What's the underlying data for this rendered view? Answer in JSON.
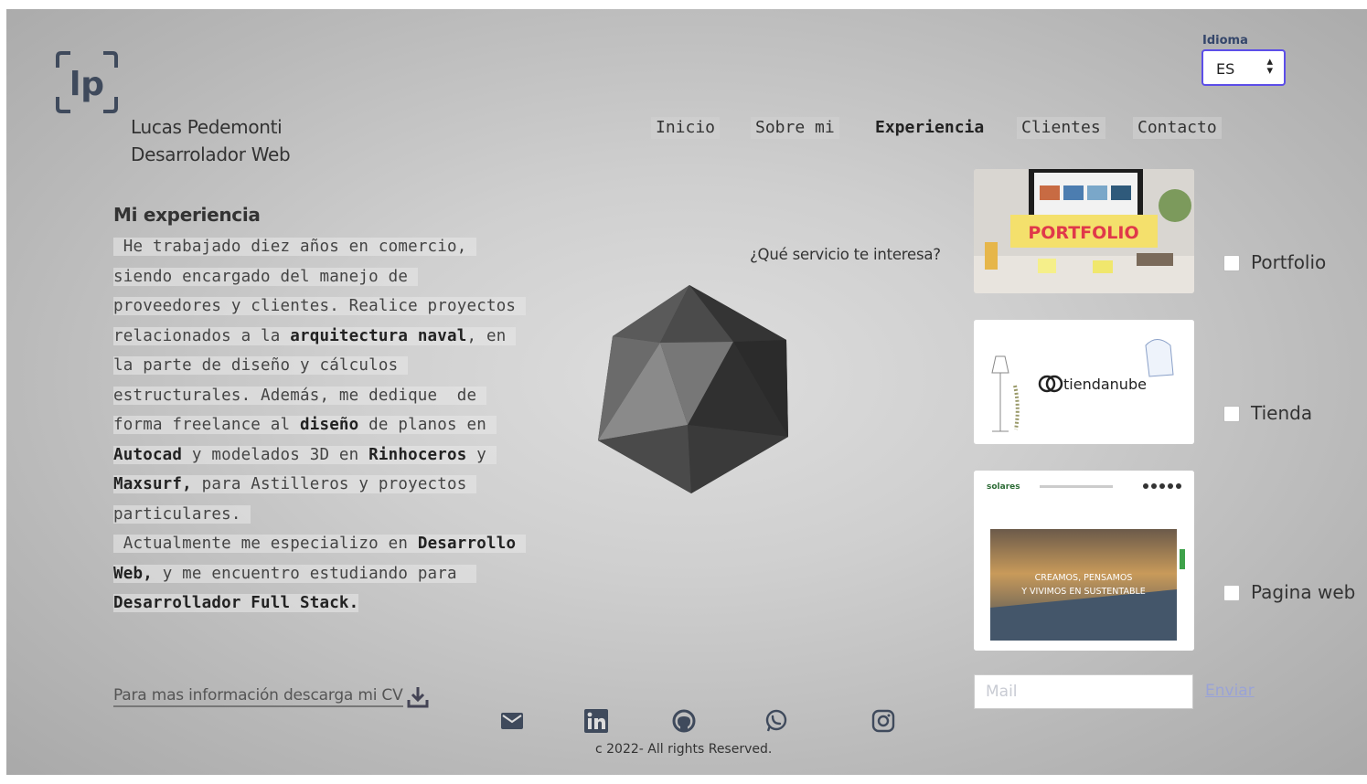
{
  "brand": {
    "logo_text": "lp",
    "name": "Lucas Pedemonti",
    "role": "Desarrolador Web"
  },
  "language": {
    "label": "Idioma",
    "selected": "ES"
  },
  "nav": [
    {
      "label": "Inicio"
    },
    {
      "label": "Sobre mi"
    },
    {
      "label": "Experiencia",
      "active": true
    },
    {
      "label": "Clientes"
    },
    {
      "label": "Contacto"
    }
  ],
  "experience": {
    "title": "Mi experiencia",
    "p1": " He trabajado diez años en comercio, siendo encargado del manejo de proveedores y clientes. Realice proyectos relacionados a la ",
    "b1": "arquitectura naval",
    "p2": ", en la parte de diseño y cálculos estructurales. Además, me dedique  de forma freelance al ",
    "b2": "diseño",
    "p3": " de planos en ",
    "b3": "Autocad",
    "p4": " y modelados 3D en ",
    "b4": "Rinhoceros",
    "p5": " y ",
    "b5": "Maxsurf,",
    "p6": " para Astilleros y proyectos particulares. ",
    "p7": " Actualmente me especializo en ",
    "b6": "Desarrollo Web,",
    "p8": " y me encuentro estudiando para ",
    "b7": " Desarrollador Full Stack.",
    "cv_link": "Para mas información descarga mi CV"
  },
  "services": {
    "question": "¿Qué servicio te interesa?",
    "options": [
      {
        "label": "Portfolio",
        "image_text": "PORTFOLIO",
        "checked": false
      },
      {
        "label": "Tienda",
        "image_text": "tiendanube",
        "checked": false
      },
      {
        "label": "Pagina web",
        "image_text_1": "CREAMOS, PENSAMOS",
        "image_text_2": "Y VIVIMOS EN SUSTENTABLE",
        "site_logo": "solares",
        "checked": false
      }
    ]
  },
  "contact_form": {
    "mail_placeholder": "Mail",
    "send_label": "Enviar"
  },
  "social": [
    "mail-icon",
    "linkedin-icon",
    "github-icon",
    "whatsapp-icon",
    "instagram-icon"
  ],
  "footer": {
    "copyright": "c 2022- All rights Reserved."
  },
  "colors": {
    "accent": "#5c4ee8",
    "send_link": "#9aa3d6",
    "text": "#333333"
  }
}
